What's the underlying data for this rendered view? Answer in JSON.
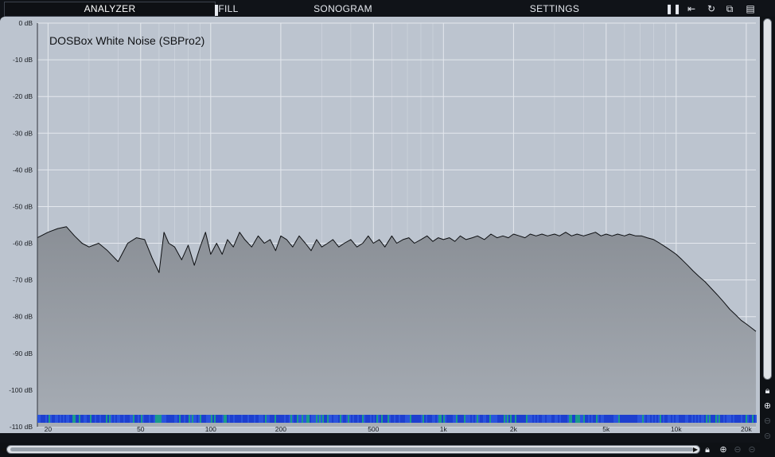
{
  "menu": {
    "tabs": [
      {
        "label": "ANALYZER",
        "active": true
      },
      {
        "label": "FILL",
        "active": false
      },
      {
        "label": "SONOGRAM",
        "active": false
      },
      {
        "label": "SETTINGS",
        "active": false
      }
    ],
    "tools": [
      "pause-icon",
      "freeze-icon",
      "reset-icon",
      "copy-icon",
      "paste-icon"
    ]
  },
  "sidebar": {
    "icons": [
      "lock-icon",
      "zoom-in-icon",
      "zoom-out-icon",
      "zoom-reset-icon"
    ]
  },
  "bottombar": {
    "icons": [
      "lock-icon",
      "zoom-in-icon",
      "zoom-out-icon",
      "zoom-reset-icon"
    ]
  },
  "colors": {
    "plot_bg": "#bcc4cf",
    "grid_major": "#e4e8ee",
    "grid_minor": "#d2d8e0",
    "fill": "#8a8f96",
    "curve": "#0d0f12",
    "sonogram_low": "#1d3fcf",
    "sonogram_high": "#1b9b8a"
  },
  "chart_data": {
    "type": "area",
    "title": "DOSBox White Noise (SBPro2)",
    "xlabel": "",
    "ylabel": "",
    "x_scale": "log",
    "xlim": [
      18,
      22000
    ],
    "ylim": [
      -110,
      0
    ],
    "y_ticks": [
      {
        "value": 0,
        "label": "0 dB"
      },
      {
        "value": -10,
        "label": "-10 dB"
      },
      {
        "value": -20,
        "label": "-20 dB"
      },
      {
        "value": -30,
        "label": "-30 dB"
      },
      {
        "value": -40,
        "label": "-40 dB"
      },
      {
        "value": -50,
        "label": "-50 dB"
      },
      {
        "value": -60,
        "label": "-60 dB"
      },
      {
        "value": -70,
        "label": "-70 dB"
      },
      {
        "value": -80,
        "label": "-80 dB"
      },
      {
        "value": -90,
        "label": "-90 dB"
      },
      {
        "value": -100,
        "label": "-100 dB"
      },
      {
        "value": -110,
        "label": "-110 dB"
      }
    ],
    "x_ticks": [
      {
        "value": 20,
        "label": "20"
      },
      {
        "value": 50,
        "label": "50"
      },
      {
        "value": 100,
        "label": "100"
      },
      {
        "value": 200,
        "label": "200"
      },
      {
        "value": 500,
        "label": "500"
      },
      {
        "value": 1000,
        "label": "1k"
      },
      {
        "value": 2000,
        "label": "2k"
      },
      {
        "value": 5000,
        "label": "5k"
      },
      {
        "value": 10000,
        "label": "10k"
      },
      {
        "value": 20000,
        "label": "20k"
      }
    ],
    "grid": true,
    "series": [
      {
        "x": [
          18,
          20,
          22,
          24,
          26,
          28,
          30,
          33,
          36,
          40,
          44,
          48,
          52,
          56,
          60,
          63,
          66,
          70,
          75,
          80,
          85,
          90,
          95,
          100,
          106,
          112,
          118,
          125,
          133,
          140,
          150,
          160,
          170,
          180,
          190,
          200,
          212,
          225,
          240,
          255,
          270,
          285,
          300,
          318,
          335,
          355,
          375,
          400,
          425,
          450,
          475,
          500,
          530,
          560,
          600,
          630,
          670,
          710,
          750,
          800,
          850,
          900,
          950,
          1000,
          1060,
          1120,
          1180,
          1250,
          1330,
          1400,
          1500,
          1600,
          1700,
          1800,
          1900,
          2000,
          2120,
          2240,
          2360,
          2500,
          2650,
          2800,
          3000,
          3150,
          3350,
          3550,
          3750,
          4000,
          4250,
          4500,
          4750,
          5000,
          5300,
          5600,
          6000,
          6300,
          6700,
          7100,
          7500,
          8000,
          8500,
          9000,
          9500,
          10000,
          10600,
          11200,
          11800,
          12500,
          13300,
          14000,
          15000,
          16000,
          17000,
          18000,
          19000,
          20000,
          21000,
          22000
        ],
        "y": [
          -58.5,
          -57,
          -56,
          -55.5,
          -58,
          -60,
          -61,
          -60,
          -62,
          -65,
          -60,
          -58.5,
          -59,
          -64,
          -68,
          -57,
          -60,
          -61,
          -64.5,
          -60.5,
          -66,
          -61,
          -57,
          -63,
          -60,
          -63,
          -59,
          -61,
          -57,
          -59,
          -61,
          -58,
          -60,
          -59,
          -62,
          -58,
          -59,
          -61,
          -58,
          -60,
          -62,
          -59,
          -61,
          -60,
          -59,
          -61,
          -60,
          -59,
          -61,
          -60,
          -58,
          -60,
          -59,
          -61,
          -58,
          -60,
          -59,
          -58.5,
          -60,
          -59,
          -58,
          -59.5,
          -58.5,
          -59,
          -58.5,
          -59.5,
          -58,
          -59,
          -58.5,
          -58,
          -59,
          -57.5,
          -58.5,
          -58,
          -58.5,
          -57.5,
          -58,
          -58.5,
          -57.5,
          -58,
          -57.5,
          -58,
          -57.5,
          -58,
          -57,
          -58,
          -57.5,
          -58,
          -57.5,
          -57,
          -58,
          -57.5,
          -58,
          -57.5,
          -58,
          -57.5,
          -58,
          -58,
          -58.5,
          -59,
          -60,
          -61,
          -62,
          -63,
          -64.5,
          -66,
          -67.5,
          -69,
          -70.5,
          -72,
          -74,
          -76,
          -78,
          -79.5,
          -81,
          -82,
          -83,
          -84
        ]
      }
    ]
  }
}
